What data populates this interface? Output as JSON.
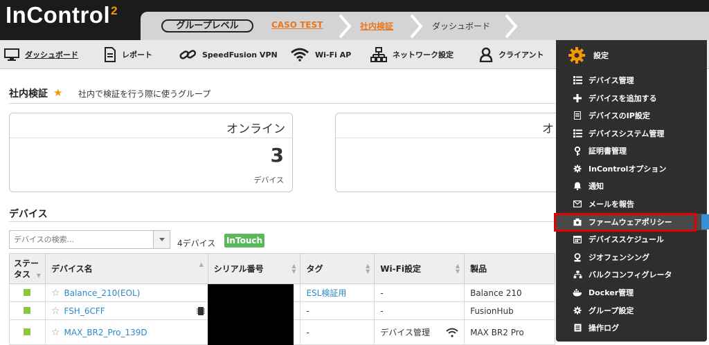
{
  "app": {
    "logo_text": "InControl",
    "logo_sup": "2"
  },
  "breadcrumb": {
    "group_level": "グループレベル",
    "org": "CASO TEST",
    "group": "社内検証",
    "page": "ダッシュボード"
  },
  "nav": {
    "dashboard": "ダッシュボード",
    "report": "レポート",
    "speedfusion": "SpeedFusion VPN",
    "wifi": "Wi-Fi AP",
    "network": "ネットワーク設定",
    "client": "クライアント",
    "settings": "設定"
  },
  "group": {
    "name": "社内検証",
    "description": "社内で検証を行う際に使うグループ"
  },
  "panels": {
    "online": {
      "title": "オンライン",
      "count": "3",
      "unit": "デバイス"
    },
    "second": {
      "title_partial": "オ"
    }
  },
  "devices": {
    "title": "デバイス",
    "search_placeholder": "デバイスの検索...",
    "count": "4デバイス",
    "intouch": "InTouch",
    "columns": [
      "ステー タス",
      "デバイス名",
      "シリアル番号",
      "タグ",
      "Wi-Fi設定",
      "製品"
    ],
    "rows": [
      {
        "name": "Balance_210(EOL)",
        "tag": "ESL検証用",
        "wifi": "-",
        "product": "Balance 210"
      },
      {
        "name": "FSH_6CFF",
        "tag": "-",
        "wifi": "-",
        "product": "FusionHub"
      },
      {
        "name": "MAX_BR2_Pro_139D",
        "tag": "-",
        "wifi": "デバイス管理",
        "product": "MAX BR2 Pro"
      }
    ]
  },
  "settings_menu": [
    "デバイス管理",
    "デバイスを追加する",
    "デバイスのIP設定",
    "デバイスシステム管理",
    "証明書管理",
    "InControlオプション",
    "通知",
    "メールを報告",
    "ファームウェアポリシー",
    "デバイススケジュール",
    "ジオフェンシング",
    "バルクコンフィグレータ",
    "Docker管理",
    "グループ設定",
    "操作ログ"
  ],
  "colors": {
    "accent": "#f39800",
    "link": "#2b8ac6",
    "highlight": "#e30000",
    "status_ok": "#8cc63f"
  }
}
